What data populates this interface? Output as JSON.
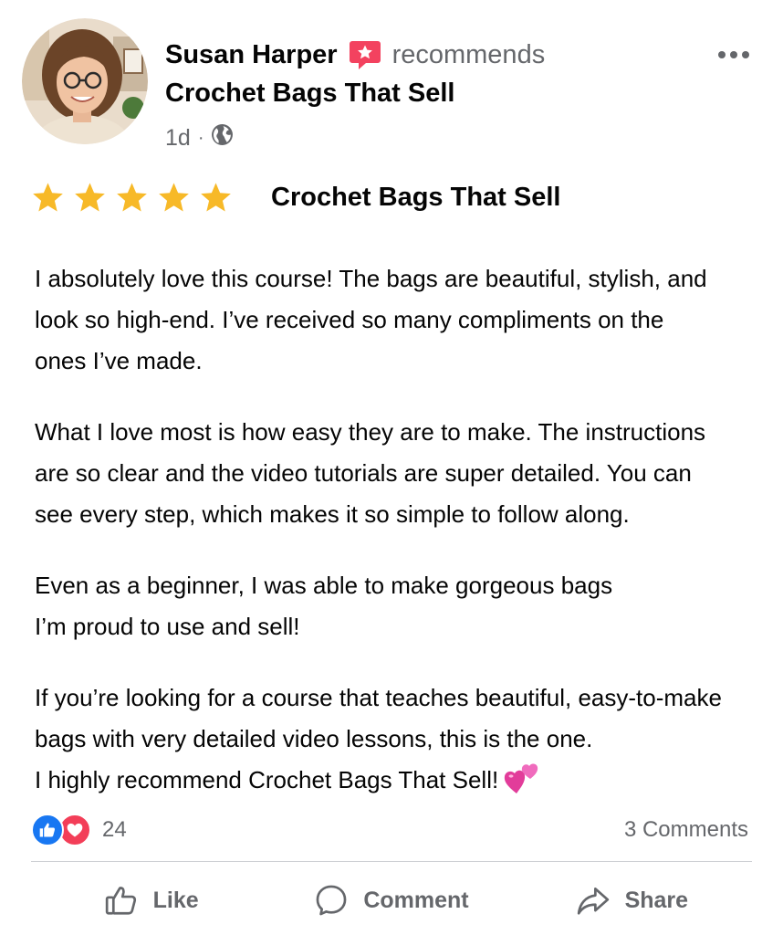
{
  "post": {
    "author_name": "Susan Harper",
    "action_text": "recommends",
    "page_name": "Crochet Bags That Sell",
    "timestamp": "1d",
    "separator": "·",
    "audience_icon": "globe-icon"
  },
  "rating": {
    "stars": 5,
    "max_stars": 5,
    "star_color": "#f7b928",
    "title": "Crochet Bags That Sell"
  },
  "review": {
    "p1_line1": "I absolutely love this course! The bags are beautiful, stylish, and",
    "p1_line2": "look so high-end. I’ve received so many compliments on the",
    "p1_line3": "ones I’ve made.",
    "p2_line1": "What I love most is how easy they are to make. The instructions",
    "p2_line2": "are so clear and the video tutorials are super detailed. You can",
    "p2_line3": "see every step, which makes it so simple to follow along.",
    "p3_line1": "Even as a beginner, I was able to make gorgeous bags",
    "p3_line2": "I’m proud to use and sell!",
    "p4_line1": "If you’re looking for a course that teaches beautiful, easy-to-make",
    "p4_line2": "bags with very detailed video lessons, this is the one.",
    "p4_line3": "I highly recommend Crochet Bags That Sell!",
    "emoji": "two-hearts-emoji"
  },
  "engagement": {
    "reaction_icons": [
      "like-reaction-icon",
      "love-reaction-icon"
    ],
    "reaction_count": "24",
    "comments_label": "3 Comments"
  },
  "actions": {
    "like_label": "Like",
    "comment_label": "Comment",
    "share_label": "Share"
  },
  "colors": {
    "like_blue": "#1877f2",
    "love_red": "#f33e58",
    "recommend_red": "#f3425f",
    "secondary_text": "#65676b"
  }
}
